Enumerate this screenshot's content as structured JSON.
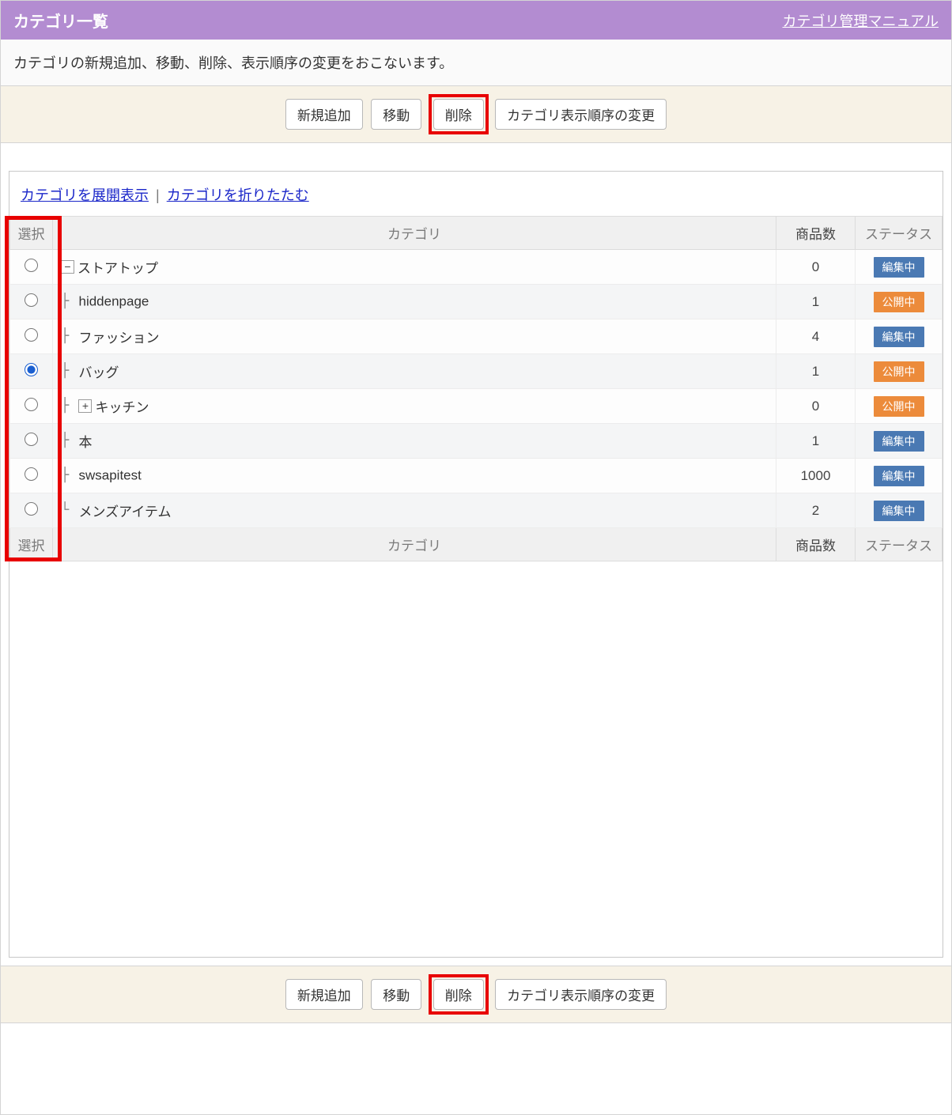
{
  "header": {
    "title": "カテゴリ一覧",
    "manual_link": "カテゴリ管理マニュアル"
  },
  "subheader": "カテゴリの新規追加、移動、削除、表示順序の変更をおこないます。",
  "toolbar": {
    "add": "新規追加",
    "move": "移動",
    "delete": "削除",
    "reorder": "カテゴリ表示順序の変更"
  },
  "links": {
    "expand": "カテゴリを展開表示",
    "collapse": "カテゴリを折りたたむ"
  },
  "table": {
    "headers": {
      "select": "選択",
      "category": "カテゴリ",
      "count": "商品数",
      "status": "ステータス"
    },
    "status_labels": {
      "editing": "編集中",
      "public": "公開中"
    },
    "rows": [
      {
        "selected": false,
        "prefix": "",
        "expand": "minus",
        "name": "ストアトップ",
        "count": "0",
        "status": "editing"
      },
      {
        "selected": false,
        "prefix": "├ ",
        "expand": "",
        "name": "hiddenpage",
        "count": "1",
        "status": "public"
      },
      {
        "selected": false,
        "prefix": "├ ",
        "expand": "",
        "name": "ファッション",
        "count": "4",
        "status": "editing"
      },
      {
        "selected": true,
        "prefix": "├ ",
        "expand": "",
        "name": "バッグ",
        "count": "1",
        "status": "public"
      },
      {
        "selected": false,
        "prefix": "├ ",
        "expand": "plus",
        "name": "キッチン",
        "count": "0",
        "status": "public"
      },
      {
        "selected": false,
        "prefix": "├ ",
        "expand": "",
        "name": "本",
        "count": "1",
        "status": "editing"
      },
      {
        "selected": false,
        "prefix": "├ ",
        "expand": "",
        "name": "swsapitest",
        "count": "1000",
        "status": "editing"
      },
      {
        "selected": false,
        "prefix": "└ ",
        "expand": "",
        "name": "メンズアイテム",
        "count": "2",
        "status": "editing"
      }
    ]
  }
}
